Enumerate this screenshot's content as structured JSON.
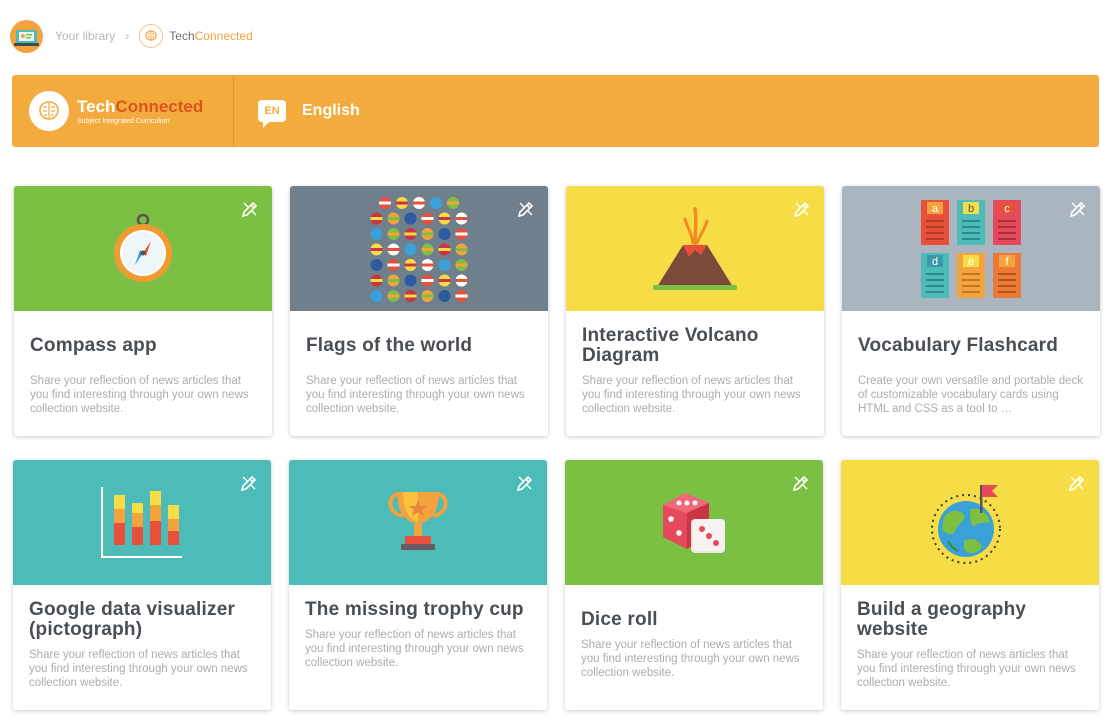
{
  "breadcrumb": {
    "library_label": "Your library",
    "separator": "›",
    "current_part1": "Tech",
    "current_part2": "Connected"
  },
  "banner": {
    "brand_part1": "Tech",
    "brand_part2": "Connected",
    "brand_subtitle": "Subject Integrated Curriculum",
    "language_code": "EN",
    "language_name": "English",
    "background_color": "#f4ab3e"
  },
  "cards": [
    {
      "title": "Compass app",
      "description": "Share your reflection of news articles that you find interesting through your own news collection website.",
      "color": "#7cc043",
      "icon": "compass-icon"
    },
    {
      "title": "Flags of the world",
      "description": "Share your reflection of news articles that you find interesting through your own news collection website.",
      "color": "#707f8c",
      "icon": "flags-icon"
    },
    {
      "title": "Interactive Volcano Diagram",
      "description": "Share your reflection of news articles that you find interesting through your own news collection website.",
      "color": "#f7dd45",
      "icon": "volcano-icon"
    },
    {
      "title": "Vocabulary Flashcard",
      "description": "Create your own versatile and portable deck of customizable vocabulary cards using HTML and CSS as a tool to …",
      "color": "#aab5c0",
      "icon": "flashcards-icon"
    },
    {
      "title": "Google data visualizer (pictograph)",
      "description": "Share your reflection of news articles that you find interesting through your own news collection website.",
      "color": "#4dbbb8",
      "icon": "bar-chart-icon"
    },
    {
      "title": "The missing trophy cup",
      "description": "Share your reflection of news articles that you find interesting through your own news collection website.",
      "color": "#4dbbb8",
      "icon": "trophy-icon"
    },
    {
      "title": "Dice roll",
      "description": "Share your reflection of news articles that you find interesting through your own news collection website.",
      "color": "#7cc043",
      "icon": "dice-icon"
    },
    {
      "title": "Build a geography website",
      "description": "Share your reflection of news articles that you find interesting through your own news collection website.",
      "color": "#f7dd45",
      "icon": "globe-flag-icon"
    }
  ],
  "flashcard_letters": [
    "a",
    "b",
    "c",
    "d",
    "e",
    "f"
  ]
}
